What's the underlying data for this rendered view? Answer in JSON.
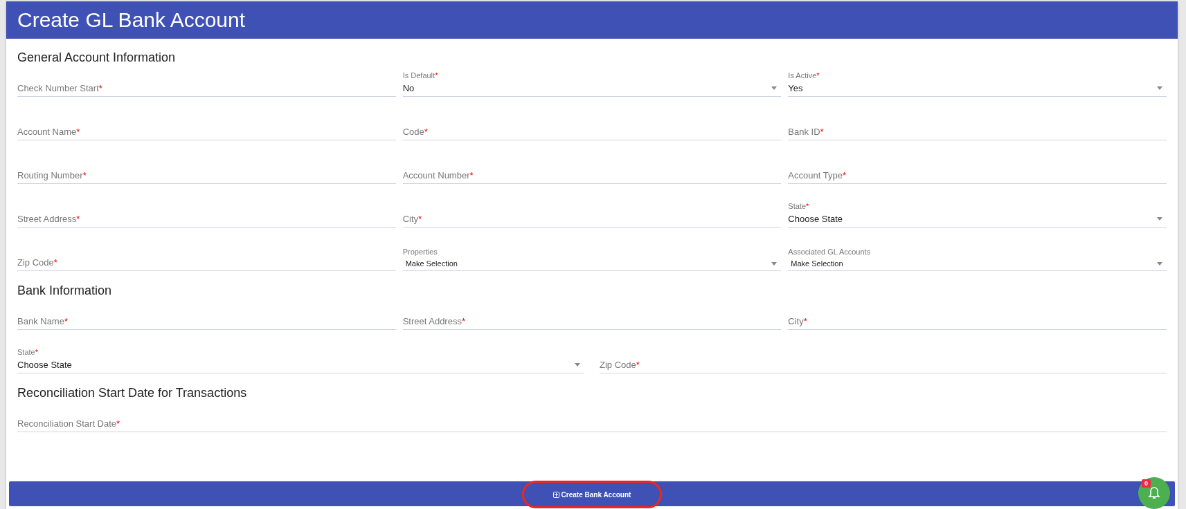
{
  "header": {
    "title": "Create GL Bank Account"
  },
  "sections": [
    {
      "title": "General Account Information",
      "rows": [
        [
          {
            "kind": "text",
            "label": "Check Number Start",
            "required_mark": "*"
          },
          {
            "kind": "select",
            "label": "Is Default",
            "required_mark": "*",
            "value": "No"
          },
          {
            "kind": "select",
            "label": "Is Active",
            "required_mark": "*",
            "value": "Yes"
          }
        ],
        [
          {
            "kind": "text",
            "label": "Account Name",
            "required_mark": "*"
          },
          {
            "kind": "text",
            "label": "Code",
            "required_mark": "*"
          },
          {
            "kind": "text",
            "label": "Bank ID",
            "required_mark": "*"
          }
        ],
        [
          {
            "kind": "text",
            "label": "Routing Number",
            "required_mark": "*"
          },
          {
            "kind": "text",
            "label": "Account Number",
            "required_mark": "*"
          },
          {
            "kind": "text",
            "label": "Account Type",
            "required_mark": "*"
          }
        ],
        [
          {
            "kind": "text",
            "label": "Street Address",
            "required_mark": "*"
          },
          {
            "kind": "text",
            "label": "City",
            "required_mark": "*"
          },
          {
            "kind": "select",
            "label": "State",
            "required_mark": "*",
            "value": "Choose State"
          }
        ],
        [
          {
            "kind": "text",
            "label": "Zip Code",
            "required_mark": "*"
          },
          {
            "kind": "multiselect",
            "label": "Properties",
            "value": "Make Selection"
          },
          {
            "kind": "multiselect",
            "label": "Associated GL Accounts",
            "value": "Make Selection"
          }
        ]
      ]
    },
    {
      "title": "Bank Information",
      "rows": [
        [
          {
            "kind": "text",
            "label": "Bank Name",
            "required_mark": "*"
          },
          {
            "kind": "text",
            "label": "Street Address",
            "required_mark": "*"
          },
          {
            "kind": "text",
            "label": "City",
            "required_mark": "*"
          }
        ],
        [
          {
            "kind": "select",
            "label": "State",
            "required_mark": "*",
            "value": "Choose State"
          },
          {
            "kind": "text",
            "label": "Zip Code",
            "required_mark": "*"
          }
        ]
      ]
    },
    {
      "title": "Reconciliation Start Date for Transactions",
      "rows": [
        [
          {
            "kind": "text",
            "label": "Reconciliation Start Date",
            "required_mark": "*"
          }
        ]
      ]
    }
  ],
  "submit_button": {
    "label": "Create Bank Account",
    "highlighted": true
  },
  "notifications": {
    "count": "0"
  }
}
